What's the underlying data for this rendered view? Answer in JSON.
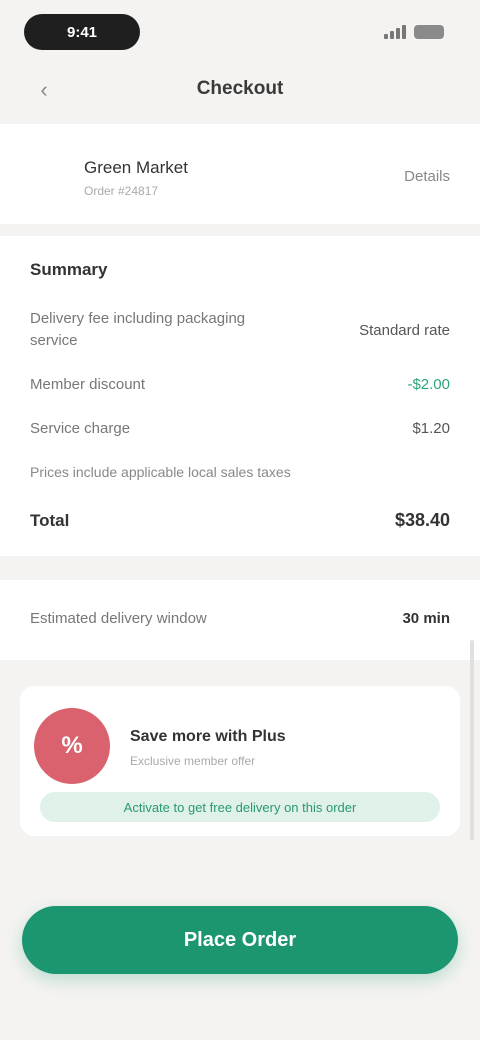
{
  "status": {
    "time": "9:41"
  },
  "nav": {
    "title": "Checkout",
    "back_icon": "chevron-left-icon"
  },
  "merchant": {
    "name": "Green Market",
    "subtitle": "Order #24817",
    "action": "Details"
  },
  "summary": {
    "title": "Summary",
    "delivery_label": "Delivery fee including packaging service",
    "delivery_value": "Standard rate",
    "discount_label": "Member discount",
    "discount_value": "-$2.00",
    "service_label": "Service charge",
    "service_value": "$1.20",
    "note": "Prices include applicable local sales taxes",
    "total_label": "Total",
    "total_value": "$38.40"
  },
  "extra": {
    "label": "Estimated delivery window",
    "value": "30 min"
  },
  "promo": {
    "badge_text": "%",
    "title": "Save more with Plus",
    "subtitle": "Exclusive member offer",
    "strip_text": "Activate to get free delivery on this order"
  },
  "cta": {
    "label": "Place Order"
  },
  "colors": {
    "accent": "#1c9670",
    "promo": "#d9626e"
  }
}
